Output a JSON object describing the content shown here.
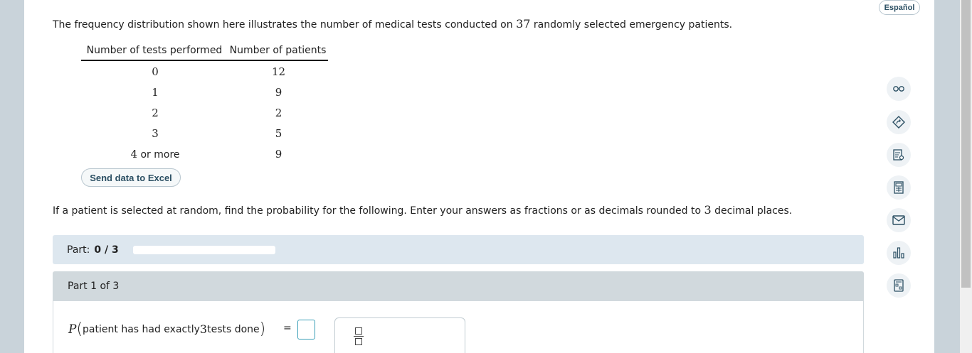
{
  "intro": {
    "before": "The frequency distribution shown here illustrates the number of medical tests conducted on ",
    "count": "37",
    "after": " randomly selected emergency patients."
  },
  "table": {
    "headers": [
      "Number of tests performed",
      "Number of patients"
    ],
    "rows": [
      {
        "tests": "0",
        "patients": "12"
      },
      {
        "tests": "1",
        "patients": "9"
      },
      {
        "tests": "2",
        "patients": "2"
      },
      {
        "tests": "3",
        "patients": "5"
      },
      {
        "tests_num": "4",
        "tests_suffix": " or more",
        "patients": "9"
      }
    ]
  },
  "excel_button": "Send data to Excel",
  "question": {
    "before": "If a patient is selected at random, find the probability for the following. Enter your answers as fractions or as decimals rounded to ",
    "places": "3",
    "after": " decimal places."
  },
  "part_bar": {
    "label": "Part:",
    "value": "0 / 3",
    "progress": 0
  },
  "part1": {
    "header": "Part 1 of 3"
  },
  "prob": {
    "P": "P",
    "open": "(",
    "text_before": "patient has had exactly ",
    "num": "3",
    "text_after": " tests done",
    "close": ")",
    "equals": "=",
    "answer": ""
  },
  "language_button": "Español",
  "tools": [
    "glasses-icon",
    "tutorial-icon",
    "notes-icon",
    "calculator-icon",
    "message-icon",
    "chart-icon",
    "keypad-icon"
  ]
}
